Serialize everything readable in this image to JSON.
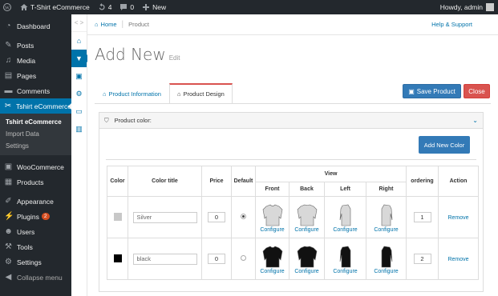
{
  "adminbar": {
    "site_name": "T-Shirt eCommerce",
    "updates_count": "4",
    "comments_count": "0",
    "new_label": "New",
    "greeting": "Howdy, admin"
  },
  "menu": {
    "dashboard": "Dashboard",
    "posts": "Posts",
    "media": "Media",
    "pages": "Pages",
    "comments": "Comments",
    "tshirt": "Tshirt eCommerce",
    "sub": [
      "Tshirt eCommerce",
      "Import Data",
      "Settings"
    ],
    "woocommerce": "WooCommerce",
    "products": "Products",
    "appearance": "Appearance",
    "plugins": "Plugins",
    "plugins_badge": "2",
    "users": "Users",
    "tools": "Tools",
    "settings": "Settings",
    "collapse": "Collapse menu"
  },
  "breadcrumb": {
    "home": "Home",
    "current": "Product",
    "help": "Help & Support"
  },
  "page": {
    "title": "Add New",
    "subtitle": "Edit"
  },
  "tabs": {
    "info": "Product Information",
    "design": "Product Design"
  },
  "buttons": {
    "save": "Save Product",
    "close": "Close",
    "add_color": "Add New Color"
  },
  "panel": {
    "heading": "Product color:"
  },
  "table": {
    "headers": {
      "color": "Color",
      "title": "Color title",
      "price": "Price",
      "default": "Default",
      "view": "View",
      "ordering": "ordering",
      "action": "Action"
    },
    "views": [
      "Front",
      "Back",
      "Left",
      "Right"
    ],
    "configure": "Configure",
    "remove": "Remove",
    "rows": [
      {
        "swatch": "#c8c8c8",
        "title": "Silver",
        "price": "0",
        "default": true,
        "ordering": "1",
        "garment": "#d8d8d8"
      },
      {
        "swatch": "#000000",
        "title": "black",
        "price": "0",
        "default": false,
        "ordering": "2",
        "garment": "#111111"
      }
    ]
  },
  "colors": {
    "primary": "#0073aa",
    "admin_dark": "#23282d",
    "save_blue": "#337ab7",
    "close_red": "#d9534f"
  }
}
